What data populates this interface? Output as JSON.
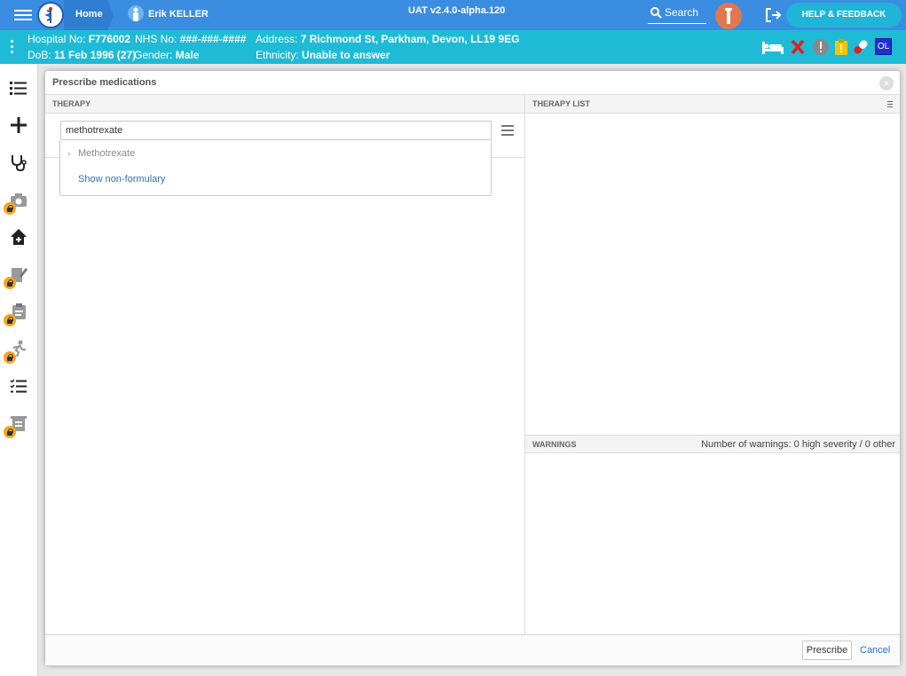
{
  "header": {
    "home_label": "Home",
    "patient_name": "Erik KELLER",
    "env_label": "UAT v2.4.0-alpha.120",
    "search_label": "Search",
    "help_label": "HELP & FEEDBACK"
  },
  "banner": {
    "hospital_no_label": "Hospital No:",
    "hospital_no": "F776002",
    "nhs_no_label": "NHS No:",
    "nhs_no": "###-###-####",
    "address_label": "Address:",
    "address": "7 Richmond St, Parkham, Devon, LL19 9EG",
    "dob_label": "DoB:",
    "dob": "11 Feb 1996 (27)",
    "gender_label": "Gender:",
    "gender": "Male",
    "ethnicity_label": "Ethnicity:",
    "ethnicity": "Unable to answer",
    "ol_badge": "OL",
    "colors": {
      "bar": "#1fbbd6",
      "alert": "#e02020",
      "warning": "#f7c600",
      "ol": "#1f2fd6"
    }
  },
  "nav": {
    "icons": [
      "list-icon",
      "plus-icon",
      "stethoscope-icon",
      "camera-icon",
      "home-plus-icon",
      "edit-document-icon",
      "clipboard-icon",
      "running-person-icon",
      "checklist-icon",
      "archive-icon"
    ]
  },
  "modal": {
    "title": "Prescribe medications",
    "therapy_header": "THERAPY",
    "therapy_list_header": "THERAPY LIST",
    "warnings_header": "WARNINGS",
    "warnings_count": "Number of warnings: 0 high severity / 0 other",
    "search": {
      "value": "methotrexate"
    },
    "dropdown": {
      "item": "Methotrexate",
      "non_formulary": "Show non-formulary"
    },
    "prescribe_label": "Prescribe",
    "cancel_label": "Cancel"
  }
}
